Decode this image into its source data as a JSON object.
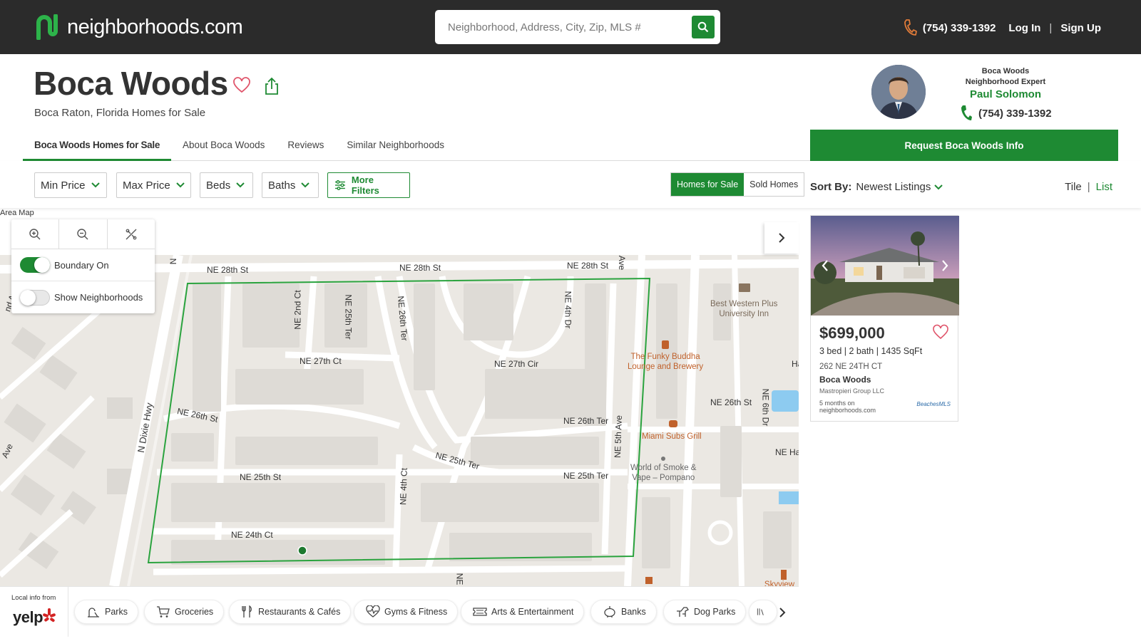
{
  "header": {
    "logo_text": "neighborhoods.com",
    "search_placeholder": "Neighborhood, Address, City, Zip, MLS #",
    "phone": "(754) 339-1392",
    "login": "Log In",
    "signup": "Sign Up",
    "sep": "|"
  },
  "page": {
    "title": "Boca Woods",
    "subtitle": "Boca Raton, Florida Homes for Sale"
  },
  "tabs": [
    {
      "label": "Boca Woods Homes for Sale"
    },
    {
      "label": "About Boca Woods"
    },
    {
      "label": "Reviews"
    },
    {
      "label": "Similar Neighborhoods"
    }
  ],
  "expert": {
    "line1": "Boca Woods",
    "line2": "Neighborhood Expert",
    "name": "Paul Solomon",
    "phone": "(754) 339-1392",
    "request_button": "Request Boca Woods Info"
  },
  "filters": {
    "min_price": "Min Price",
    "max_price": "Max Price",
    "beds": "Beds",
    "baths": "Baths",
    "more": "More Filters",
    "homes_for_sale": "Homes for Sale",
    "sold_homes": "Sold Homes",
    "sort_label": "Sort By:",
    "sort_value": "Newest Listings",
    "view_tile": "Tile",
    "view_sep": "|",
    "view_list": "List"
  },
  "map": {
    "area_label": "Area Map",
    "boundary_label": "Boundary On",
    "show_neighborhoods_label": "Show Neighborhoods",
    "boundary_on": true,
    "show_neighborhoods_on": false,
    "streets": [
      "NE 28th St",
      "NE 28th St",
      "NE 28th St",
      "NE 2nd Ct",
      "NE 25th Ter",
      "NE 26th Ter",
      "NE 4th Dr",
      "NE 27th Ct",
      "NE 27th Cir",
      "NE 26th St",
      "NE 26th Ter",
      "NE 26th St",
      "NE 6th Dr",
      "N Dixie Hwy",
      "NE 25th Ter",
      "NE 25th St",
      "NE 25th Ter",
      "NE 4th Ct",
      "NE 5th Ave",
      "NE 24th Ct",
      "Ave",
      "Ha",
      "NE Ha",
      "N",
      "NE",
      "nd Av",
      "Ave"
    ],
    "pois": [
      {
        "name": "Best Western Plus University Inn",
        "line1": "Best Western Plus",
        "line2": "University Inn"
      },
      {
        "name": "The Funky Buddha Lounge and Brewery",
        "line1": "The Funky Buddha",
        "line2": "Lounge and Brewery"
      },
      {
        "name": "Miami Subs Grill",
        "line1": "Miami Subs Grill",
        "line2": ""
      },
      {
        "name": "World of Smoke & Vape – Pompano",
        "line1": "World of Smoke &",
        "line2": "Vape – Pompano"
      },
      {
        "name": "Skyview Cafe",
        "line1": "Skyview Ca",
        "line2": ""
      }
    ]
  },
  "yelp": {
    "caption": "Local info from",
    "brand": "yelp",
    "categories": [
      "Parks",
      "Groceries",
      "Restaurants & Cafés",
      "Gyms & Fitness",
      "Arts & Entertainment",
      "Banks",
      "Dog Parks"
    ]
  },
  "listing": {
    "price": "$699,000",
    "beds": "3 bed",
    "baths": "2 bath",
    "sqft": "1435 SqFt",
    "address": "262 NE 24TH CT",
    "neighborhood": "Boca Woods",
    "broker": "Mastropieri Group LLC",
    "age_line1": "5 months on",
    "age_line2": "neighborhoods.com",
    "mls_logo": "BeachesMLS",
    "spec_sep": "|"
  },
  "colors": {
    "brand_green": "#1e8a33",
    "header_bg": "#2b2b2b",
    "poi_orange": "#c0612b"
  }
}
